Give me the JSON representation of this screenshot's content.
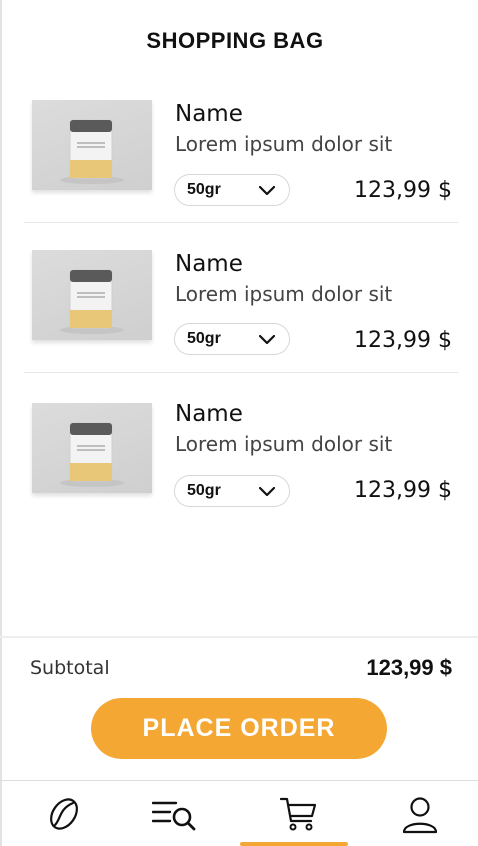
{
  "header": {
    "title": "SHOPPING BAG"
  },
  "items": [
    {
      "name": "Name",
      "description": "Lorem ipsum dolor sit",
      "weight": "50gr",
      "price": "123,99 $",
      "package_text": "Tea Package Mockup"
    },
    {
      "name": "Name",
      "description": "Lorem ipsum dolor sit",
      "weight": "50gr",
      "price": "123,99 $",
      "package_text": "Tea Package Mockup"
    },
    {
      "name": "Name",
      "description": "Lorem ipsum dolor sit",
      "weight": "50gr",
      "price": "123,99 $",
      "package_text": "Tea Package Mockup"
    }
  ],
  "summary": {
    "subtotal_label": "Subtotal",
    "subtotal_value": "123,99 $"
  },
  "actions": {
    "place_order_label": "PLACE ORDER"
  },
  "nav": {
    "items": [
      {
        "icon": "coffee-bean-icon"
      },
      {
        "icon": "search-menu-icon"
      },
      {
        "icon": "cart-icon",
        "active": true
      },
      {
        "icon": "user-icon"
      }
    ]
  },
  "colors": {
    "accent": "#f5a733",
    "text": "#111111",
    "muted": "#444444"
  }
}
